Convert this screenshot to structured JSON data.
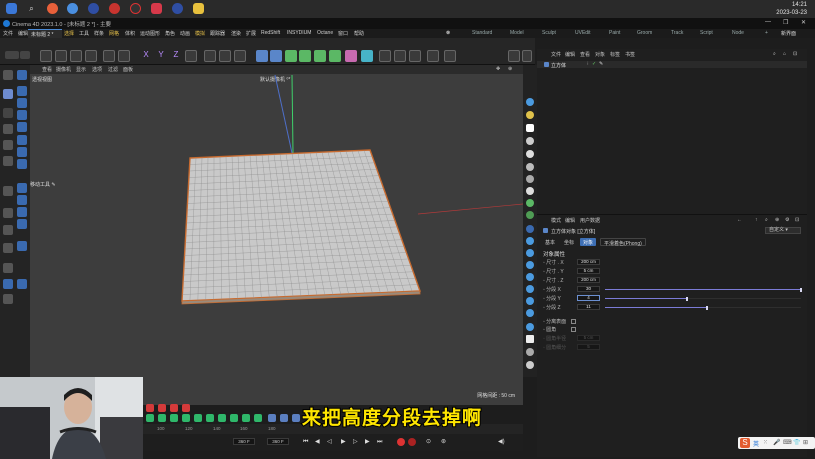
{
  "clock": {
    "time": "14:21",
    "date": "2023-03-23"
  },
  "window": {
    "title": "Cinema 4D 2023.1.0 - [未标题 2 *] - 主要"
  },
  "doc_tab": {
    "label": "未标题 2 *"
  },
  "menus": [
    "文件",
    "编辑",
    "创建",
    "模式",
    "选择",
    "工具",
    "样条",
    "网格",
    "体积",
    "运动图形",
    "角色",
    "动画",
    "模拟",
    "跟踪器",
    "渲染",
    "扩展",
    "RedShift",
    "INSYDIUM",
    "Octane",
    "窗口",
    "帮助"
  ],
  "modes": [
    "Standard",
    "Model",
    "Sculpt",
    "UVEdit",
    "Paint",
    "Groom",
    "Track",
    "Script",
    "Node"
  ],
  "new_layout_label": "新界面",
  "axes": {
    "x": "X",
    "y": "Y",
    "z": "Z"
  },
  "viewport": {
    "menu": [
      "查看",
      "摄像机",
      "显示",
      "选项",
      "过滤",
      "面板"
    ],
    "view_label": "透视视图",
    "camera_label": "默认摄像机 ⁰*",
    "tool_label": "移动工具 ✎",
    "grid_spacing": "网格间距 : 50 cm"
  },
  "object_manager": {
    "tabs": [
      "文件",
      "编辑",
      "查看",
      "对象",
      "标签",
      "书签"
    ],
    "object_name": "立方体",
    "icon": "cube-icon"
  },
  "attribute_manager": {
    "tabs": [
      "模式",
      "编辑",
      "用户数据"
    ],
    "title": "立方体对象 [立方体]",
    "dropdown": "自定义",
    "sub_tabs": [
      "基本",
      "坐标",
      "对象",
      "平滑着色(Phong)"
    ],
    "active_sub_tab": "对象",
    "section_title": "对象属性",
    "size_x": {
      "label": "尺寸 . X",
      "value": "200 cm"
    },
    "size_y": {
      "label": "尺寸 . Y",
      "value": "5 cm"
    },
    "size_z": {
      "label": "尺寸 . Z",
      "value": "200 cm"
    },
    "seg_x": {
      "label": "分段 X",
      "value": "30",
      "fraction": 1.0
    },
    "seg_y": {
      "label": "分段 Y",
      "value": "4",
      "fraction": 0.42
    },
    "seg_z": {
      "label": "分段 Z",
      "value": "11",
      "fraction": 0.52
    },
    "separate_surfaces": {
      "label": "分离表面",
      "checked": false
    },
    "fillet": {
      "label": "圆角",
      "checked": false
    },
    "fillet_radius": {
      "label": "圆角半径",
      "value": "5 cm"
    },
    "fillet_subdiv": {
      "label": "圆角细分",
      "value": "5"
    }
  },
  "timeline": {
    "ticks": [
      "100",
      "120",
      "140",
      "160",
      "180"
    ],
    "start_frame": "360 F",
    "end_frame": "360 F"
  },
  "subtitle": "来把高度分段去掉啊",
  "ime": {
    "lang": "英"
  }
}
